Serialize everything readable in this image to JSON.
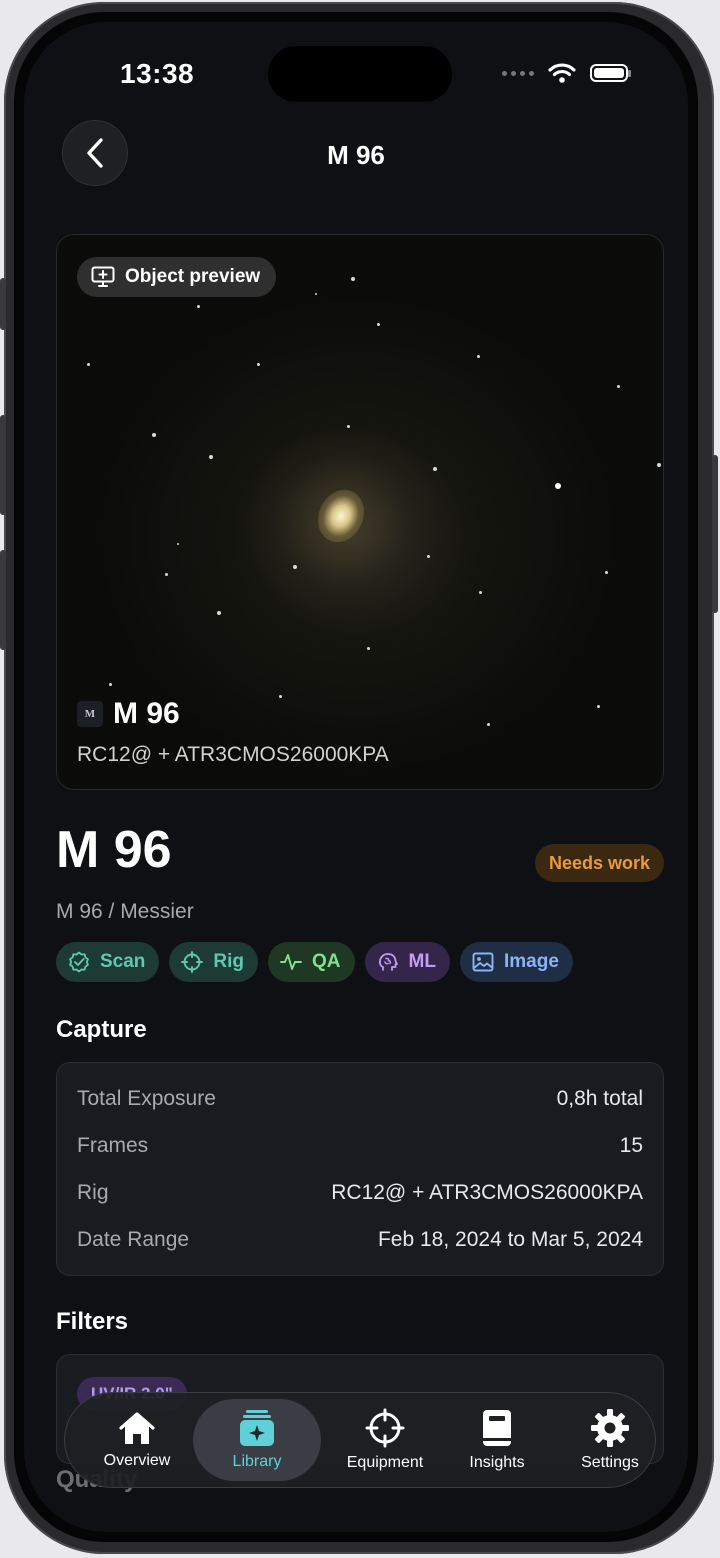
{
  "status_bar": {
    "time": "13:38"
  },
  "nav": {
    "title": "M 96"
  },
  "preview": {
    "chip_label": "Object preview",
    "thumb_glyph": "M",
    "name": "M 96",
    "rig": "RC12@ + ATR3CMOS26000KPA"
  },
  "object": {
    "title": "M 96",
    "subtitle": "M 96 / Messier",
    "status": "Needs work",
    "status_color": "#e89a3c"
  },
  "tags": [
    {
      "label": "Scan",
      "icon": "scan-badge-icon",
      "color": "#5fc9b0",
      "bg": "#1d3a34"
    },
    {
      "label": "Rig",
      "icon": "crosshair-icon",
      "color": "#5fc9b0",
      "bg": "#1d3a34"
    },
    {
      "label": "QA",
      "icon": "pulse-icon",
      "color": "#7fe38a",
      "bg": "#1f3824"
    },
    {
      "label": "ML",
      "icon": "brain-icon",
      "color": "#c39cf5",
      "bg": "#33264a"
    },
    {
      "label": "Image",
      "icon": "image-icon",
      "color": "#8cb4f5",
      "bg": "#1f2d45"
    }
  ],
  "capture": {
    "label": "Capture",
    "rows": [
      {
        "key": "Total Exposure",
        "value": "0,8h total"
      },
      {
        "key": "Frames",
        "value": "15"
      },
      {
        "key": "Rig",
        "value": "RC12@ + ATR3CMOS26000KPA"
      },
      {
        "key": "Date Range",
        "value": "Feb 18, 2024 to Mar 5, 2024"
      }
    ]
  },
  "filters": {
    "label": "Filters",
    "chip": "UV/IR 2.0\""
  },
  "quality": {
    "label": "Quality"
  },
  "tabbar": {
    "active": "Library",
    "active_color": "#5fd0d8",
    "items": [
      {
        "label": "Overview",
        "icon": "house-icon"
      },
      {
        "label": "Library",
        "icon": "library-sparkle-icon"
      },
      {
        "label": "Equipment",
        "icon": "crosshair-icon"
      },
      {
        "label": "Insights",
        "icon": "book-icon"
      },
      {
        "label": "Settings",
        "icon": "gear-icon"
      }
    ]
  }
}
